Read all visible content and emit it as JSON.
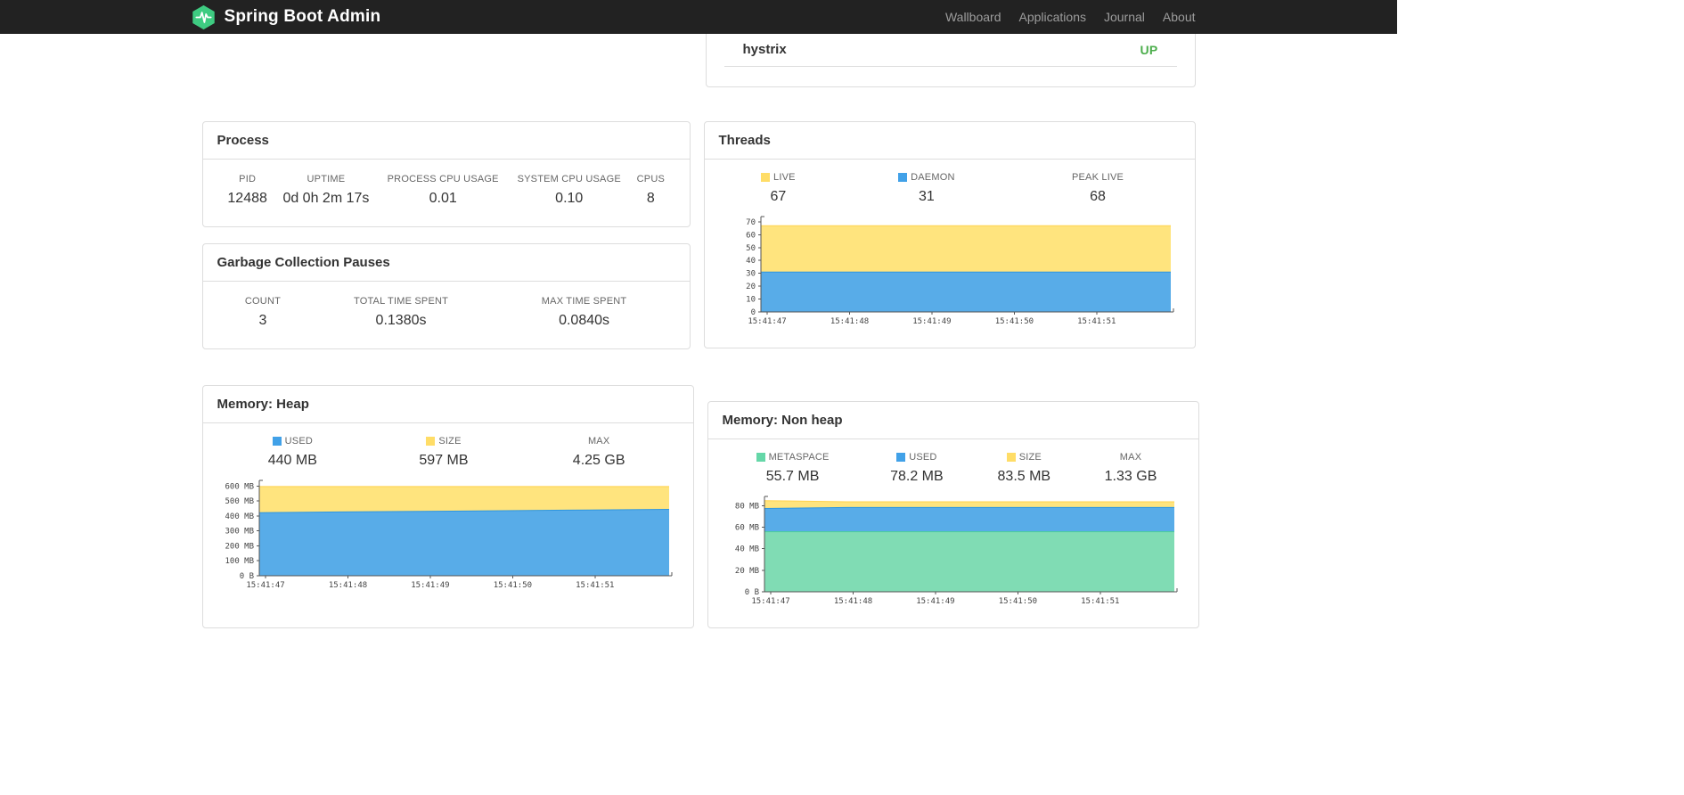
{
  "navbar": {
    "brand": "Spring Boot Admin",
    "links": [
      "Wallboard",
      "Applications",
      "Journal",
      "About"
    ]
  },
  "colors": {
    "brand_icon": "#3ecb81",
    "status_up": "#4cae4c",
    "legend_yellow": "#ffdd67",
    "legend_blue": "#41a1e8",
    "legend_green": "#65d7a8"
  },
  "applications": {
    "app_name": "hystrix",
    "app_status": "UP"
  },
  "panels": {
    "process": {
      "title": "Process",
      "metrics": [
        {
          "label": "PID",
          "value": "12488"
        },
        {
          "label": "UPTIME",
          "value": "0d 0h 2m 17s"
        },
        {
          "label": "PROCESS CPU USAGE",
          "value": "0.01"
        },
        {
          "label": "SYSTEM CPU USAGE",
          "value": "0.10"
        },
        {
          "label": "CPUS",
          "value": "8"
        }
      ]
    },
    "gc": {
      "title": "Garbage Collection Pauses",
      "metrics": [
        {
          "label": "COUNT",
          "value": "3"
        },
        {
          "label": "TOTAL TIME SPENT",
          "value": "0.1380s"
        },
        {
          "label": "MAX TIME SPENT",
          "value": "0.0840s"
        }
      ]
    },
    "threads": {
      "title": "Threads",
      "metrics": [
        {
          "label": "LIVE",
          "value": "67",
          "swatch": "#ffdd67"
        },
        {
          "label": "DAEMON",
          "value": "31",
          "swatch": "#41a1e8"
        },
        {
          "label": "PEAK LIVE",
          "value": "68"
        }
      ]
    },
    "heap": {
      "title": "Memory: Heap",
      "metrics": [
        {
          "label": "USED",
          "value": "440 MB",
          "swatch": "#41a1e8"
        },
        {
          "label": "SIZE",
          "value": "597 MB",
          "swatch": "#ffdd67"
        },
        {
          "label": "MAX",
          "value": "4.25 GB"
        }
      ]
    },
    "nonheap": {
      "title": "Memory: Non heap",
      "metrics": [
        {
          "label": "METASPACE",
          "value": "55.7 MB",
          "swatch": "#65d7a8"
        },
        {
          "label": "USED",
          "value": "78.2 MB",
          "swatch": "#41a1e8"
        },
        {
          "label": "SIZE",
          "value": "83.5 MB",
          "swatch": "#ffdd67"
        },
        {
          "label": "MAX",
          "value": "1.33 GB"
        }
      ]
    }
  },
  "chart_data": [
    {
      "id": "threads",
      "type": "area",
      "title": "Threads",
      "legend": [
        {
          "name": "LIVE",
          "value": 67
        },
        {
          "name": "DAEMON",
          "value": 31
        },
        {
          "name": "PEAK LIVE",
          "value": 68
        }
      ],
      "x_labels": [
        "15:41:47",
        "15:41:48",
        "15:41:49",
        "15:41:50",
        "15:41:51"
      ],
      "ylim": [
        0,
        72
      ],
      "yticks": [
        {
          "v": 0,
          "label": "0"
        },
        {
          "v": 10,
          "label": "10"
        },
        {
          "v": 20,
          "label": "20"
        },
        {
          "v": 30,
          "label": "30"
        },
        {
          "v": 40,
          "label": "40"
        },
        {
          "v": 50,
          "label": "50"
        },
        {
          "v": 60,
          "label": "60"
        },
        {
          "v": 70,
          "label": "70"
        }
      ],
      "series": [
        {
          "name": "LIVE",
          "fill": "#ffe47e",
          "stroke": "#ffd24d",
          "values": [
            67,
            67,
            67,
            67,
            67,
            67
          ]
        },
        {
          "name": "DAEMON",
          "fill": "#58ace8",
          "stroke": "#2e96e0",
          "values": [
            31,
            31,
            31,
            31,
            31,
            31
          ]
        }
      ]
    },
    {
      "id": "heap",
      "type": "area",
      "title": "Memory: Heap",
      "legend": [
        {
          "name": "USED",
          "value": "440 MB"
        },
        {
          "name": "SIZE",
          "value": "597 MB"
        },
        {
          "name": "MAX",
          "value": "4.25 GB"
        }
      ],
      "x_labels": [
        "15:41:47",
        "15:41:48",
        "15:41:49",
        "15:41:50",
        "15:41:51"
      ],
      "ylim": [
        0,
        620
      ],
      "yticks": [
        {
          "v": 0,
          "label": "0 B"
        },
        {
          "v": 100,
          "label": "100 MB"
        },
        {
          "v": 200,
          "label": "200 MB"
        },
        {
          "v": 300,
          "label": "300 MB"
        },
        {
          "v": 400,
          "label": "400 MB"
        },
        {
          "v": 500,
          "label": "500 MB"
        },
        {
          "v": 600,
          "label": "600 MB"
        }
      ],
      "series": [
        {
          "name": "SIZE",
          "fill": "#ffe47e",
          "stroke": "#ffd24d",
          "values": [
            597,
            597,
            597,
            597,
            597,
            597
          ]
        },
        {
          "name": "USED",
          "fill": "#58ace8",
          "stroke": "#2e96e0",
          "values": [
            422,
            427,
            431,
            435,
            440,
            444
          ]
        }
      ]
    },
    {
      "id": "nonheap",
      "type": "area",
      "title": "Memory: Non heap",
      "legend": [
        {
          "name": "METASPACE",
          "value": "55.7 MB"
        },
        {
          "name": "USED",
          "value": "78.2 MB"
        },
        {
          "name": "SIZE",
          "value": "83.5 MB"
        },
        {
          "name": "MAX",
          "value": "1.33 GB"
        }
      ],
      "x_labels": [
        "15:41:47",
        "15:41:48",
        "15:41:49",
        "15:41:50",
        "15:41:51"
      ],
      "ylim": [
        0,
        86
      ],
      "yticks": [
        {
          "v": 0,
          "label": "0 B"
        },
        {
          "v": 20,
          "label": "20 MB"
        },
        {
          "v": 40,
          "label": "40 MB"
        },
        {
          "v": 60,
          "label": "60 MB"
        },
        {
          "v": 80,
          "label": "80 MB"
        }
      ],
      "series": [
        {
          "name": "SIZE",
          "fill": "#ffe47e",
          "stroke": "#ffd24d",
          "values": [
            84.6,
            83.5,
            83.5,
            83.5,
            83.5,
            83.5
          ]
        },
        {
          "name": "USED",
          "fill": "#58ace8",
          "stroke": "#2e96e0",
          "values": [
            77.3,
            78.2,
            78.2,
            78.2,
            78.2,
            78.2
          ]
        },
        {
          "name": "METASPACE",
          "fill": "#80dcb4",
          "stroke": "#4ecf9b",
          "values": [
            55.7,
            55.7,
            55.7,
            55.7,
            55.7,
            55.7
          ]
        }
      ]
    }
  ]
}
